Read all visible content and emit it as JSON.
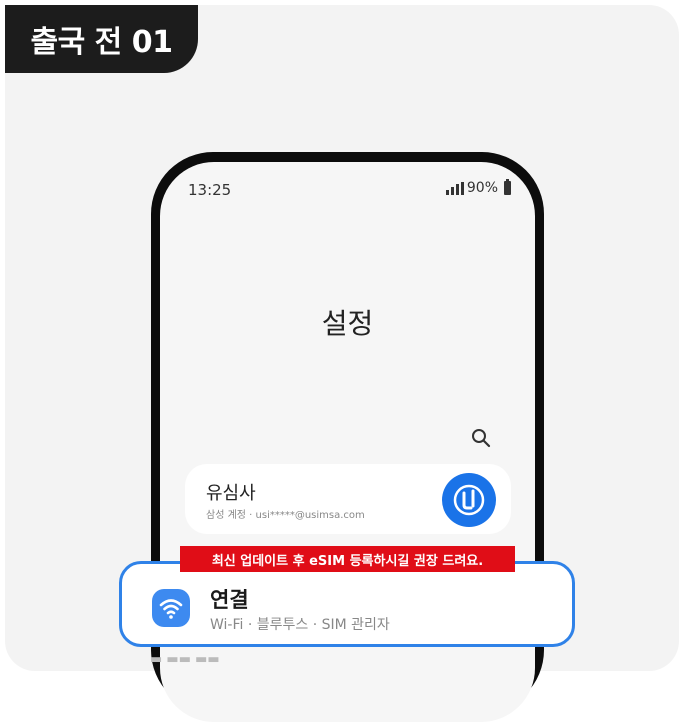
{
  "badge": {
    "label": "출국 전 01"
  },
  "status_bar": {
    "time": "13:25",
    "battery": "90%"
  },
  "settings": {
    "title": "설정"
  },
  "account": {
    "name": "유심사",
    "detail": "삼성 계정 · usi*****@usimsa.com",
    "avatar_color": "#1a73e8"
  },
  "notice": {
    "text": "최신 업데이트 후 eSIM 등록하시길 권장 드려요.",
    "color": "#e00d17"
  },
  "connections": {
    "title": "연결",
    "subtitle": "Wi-Fi  ·  블루투스  ·  SIM 관리자",
    "accent": "#2f82e8"
  },
  "icons": [
    "wifi-icon",
    "search-icon",
    "signal-icon",
    "battery-icon",
    "account-logo-icon"
  ]
}
